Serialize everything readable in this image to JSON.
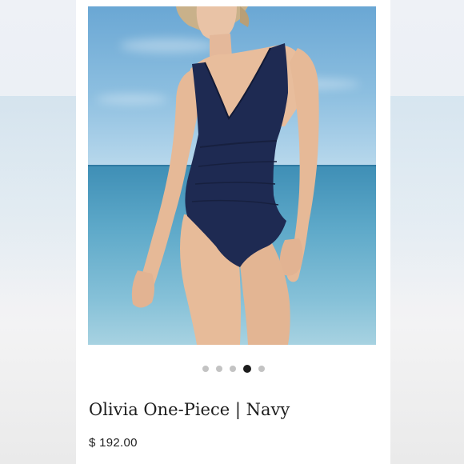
{
  "product": {
    "title": "Olivia One-Piece | Navy",
    "price": "$ 192.00",
    "image_alt": "Woman wearing a navy v-neck one-piece swimsuit on a beach",
    "swimsuit_color": "#1e2a52"
  },
  "carousel": {
    "total": 5,
    "active_index": 3,
    "active_color": "#1c1c1c",
    "inactive_color": "#c3c3c3"
  }
}
